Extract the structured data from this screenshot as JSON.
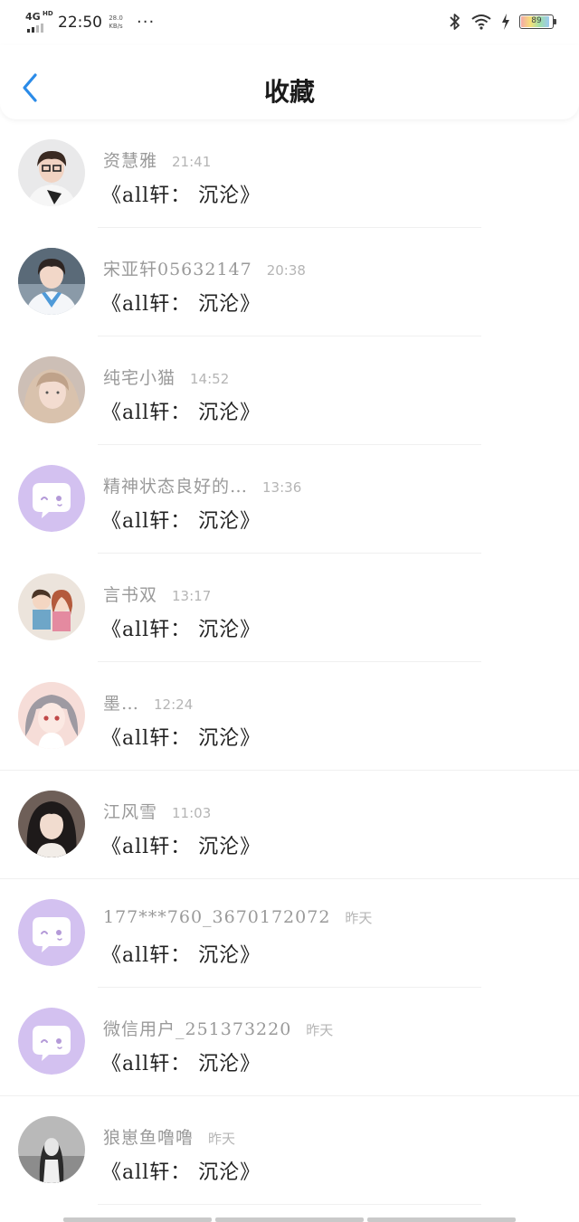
{
  "status_bar": {
    "network": "4G",
    "network_hd": "HD",
    "time": "22:50",
    "speed_value": "28.0",
    "speed_unit": "KB/s",
    "more": "···",
    "battery": "89"
  },
  "header": {
    "title": "收藏",
    "back_icon": "chevron-left-icon",
    "accent_color": "#2b8be8"
  },
  "favorites": [
    {
      "name": "资慧雅",
      "time": "21:41",
      "book": "《all轩： 沉沦》",
      "avatar": "photo-glasses-boy"
    },
    {
      "name": "宋亚轩05632147",
      "time": "20:38",
      "book": "《all轩： 沉沦》",
      "avatar": "photo-blue-sailor-boy"
    },
    {
      "name": "纯宅小猫",
      "time": "14:52",
      "book": "《all轩： 沉沦》",
      "avatar": "photo-girl-blonde"
    },
    {
      "name": "精神状态良好的…",
      "time": "13:36",
      "book": "《all轩： 沉沦》",
      "avatar": "default-chat-bubble"
    },
    {
      "name": "言书双",
      "time": "13:17",
      "book": "《all轩： 沉沦》",
      "avatar": "cartoon-couple"
    },
    {
      "name": "墨…",
      "time": "12:24",
      "book": "《all轩： 沉沦》",
      "avatar": "anime-girl"
    },
    {
      "name": "江风雪",
      "time": "11:03",
      "book": "《all轩： 沉沦》",
      "avatar": "photo-dark-hair-girl"
    },
    {
      "name": "177***760_3670172072",
      "time": "昨天",
      "book": "《all轩： 沉沦》",
      "avatar": "default-chat-bubble"
    },
    {
      "name": "微信用户_251373220",
      "time": "昨天",
      "book": "《all轩： 沉沦》",
      "avatar": "default-chat-bubble"
    },
    {
      "name": "狼崽鱼噜噜",
      "time": "昨天",
      "book": "《all轩： 沉沦》",
      "avatar": "photo-bw-girl"
    }
  ]
}
